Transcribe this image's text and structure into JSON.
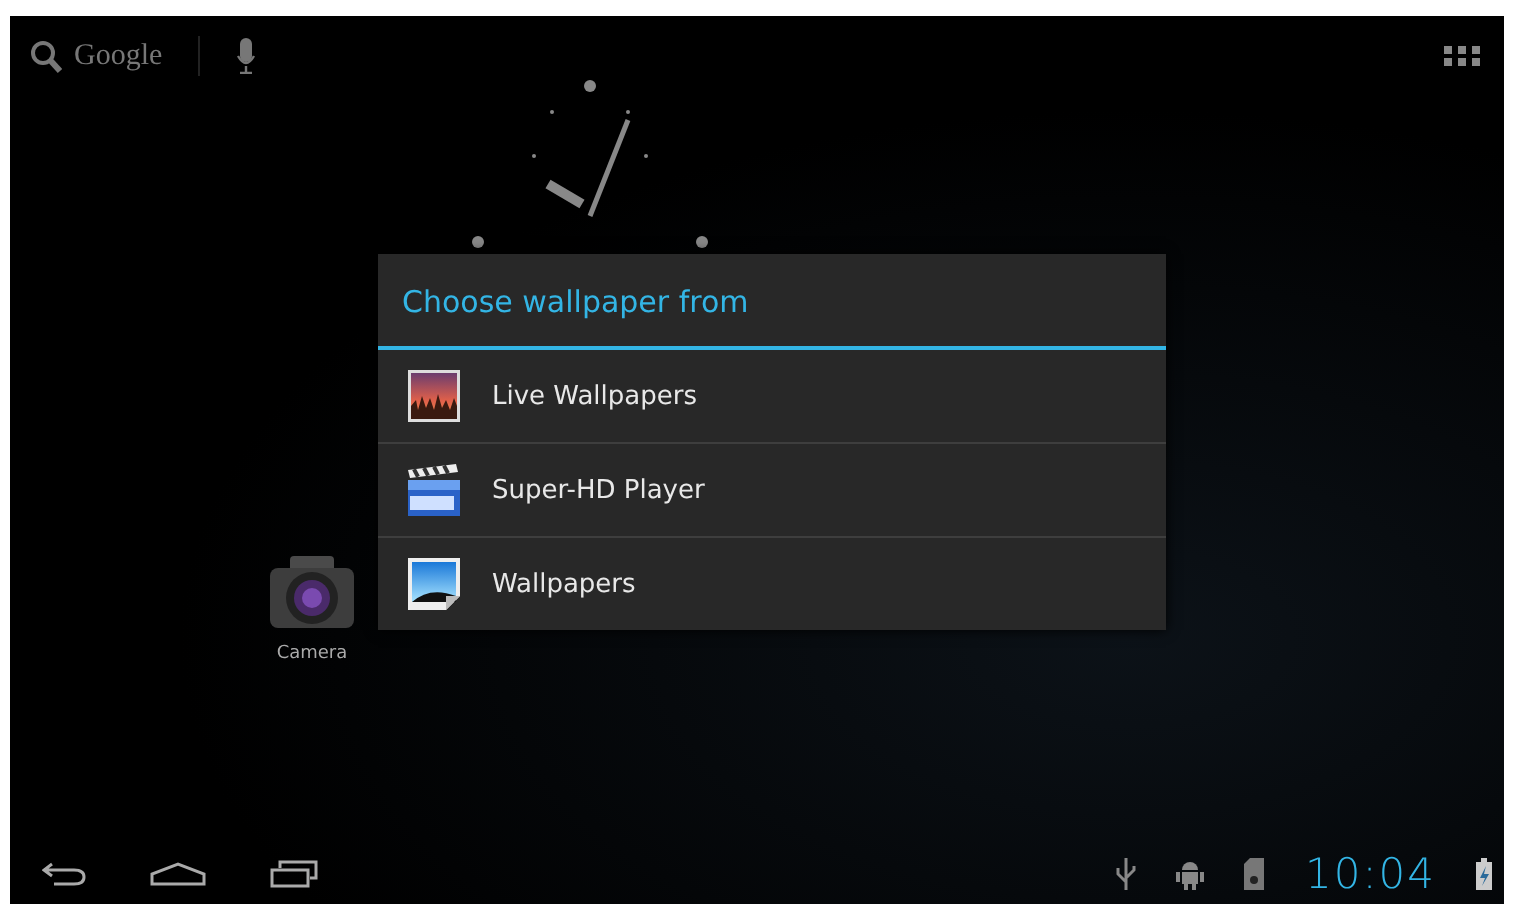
{
  "search": {
    "label": "Google"
  },
  "shortcuts": [
    {
      "label": "Camera",
      "kind": "camera"
    }
  ],
  "dialog": {
    "title": "Choose wallpaper from",
    "items": [
      {
        "label": "Live Wallpapers",
        "kind": "sunset"
      },
      {
        "label": "Super-HD Player",
        "kind": "clapper"
      },
      {
        "label": "Wallpapers",
        "kind": "landscape"
      }
    ]
  },
  "status_bar": {
    "time": "10:04"
  }
}
